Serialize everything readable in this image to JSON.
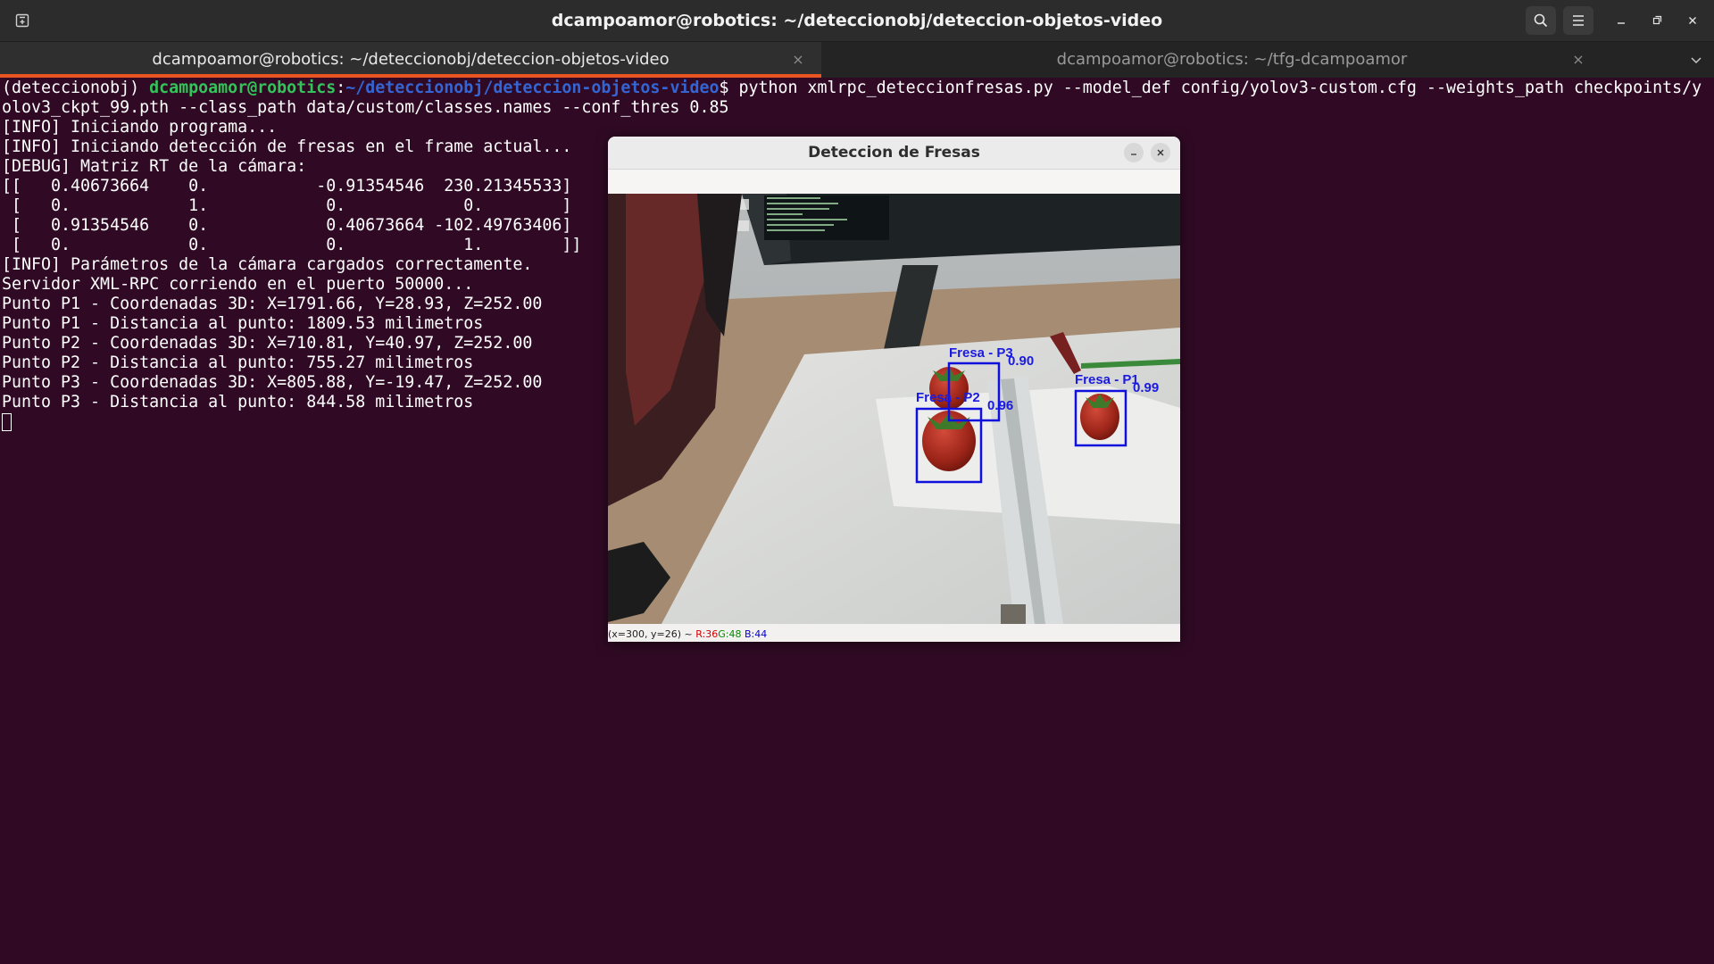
{
  "header": {
    "title": "dcampoamor@robotics: ~/deteccionobj/deteccion-objetos-video",
    "icons": [
      "new-tab-icon",
      "search-icon",
      "hamburger-menu-icon",
      "minimize-icon",
      "maximize-icon",
      "close-icon"
    ]
  },
  "tabs": [
    {
      "label": "dcampoamor@robotics: ~/deteccionobj/deteccion-objetos-video",
      "active": true,
      "close": "×"
    },
    {
      "label": "dcampoamor@robotics: ~/tfg-dcampoamor",
      "active": false,
      "close": "×"
    }
  ],
  "terminal": {
    "prompt": {
      "env": "(deteccionobj) ",
      "user_host": "dcampoamor@robotics",
      "sep": ":",
      "path": "~/deteccionobj/deteccion-objetos-video",
      "dollar": "$ ",
      "command": "python xmlrpc_deteccionfresas.py --model_def config/yolov3-custom.cfg --weights_path checkpoints/y"
    },
    "lines": [
      "olov3_ckpt_99.pth --class_path data/custom/classes.names --conf_thres 0.85",
      "[INFO] Iniciando programa...",
      "[INFO] Iniciando detección de fresas en el frame actual...",
      "[DEBUG] Matriz RT de la cámara:",
      "[[   0.40673664    0.           -0.91354546  230.21345533]",
      " [   0.            1.            0.            0.        ]",
      " [   0.91354546    0.            0.40673664 -102.49763406]",
      " [   0.            0.            0.            1.        ]]",
      "[INFO] Parámetros de la cámara cargados correctamente.",
      "Servidor XML-RPC corriendo en el puerto 50000...",
      "Punto P1 - Coordenadas 3D: X=1791.66, Y=28.93, Z=252.00",
      "Punto P1 - Distancia al punto: 1809.53 milimetros",
      "Punto P2 - Coordenadas 3D: X=710.81, Y=40.97, Z=252.00",
      "Punto P2 - Distancia al punto: 755.27 milimetros",
      "Punto P3 - Coordenadas 3D: X=805.88, Y=-19.47, Z=252.00",
      "Punto P3 - Distancia al punto: 844.58 milimetros"
    ]
  },
  "detection_window": {
    "title": "Deteccion de Fresas",
    "buttons": [
      "minimize",
      "close"
    ],
    "detections": [
      {
        "label": "Fresa - P3",
        "score": "0.90"
      },
      {
        "label": "Fresa - P2",
        "score": "0.96"
      },
      {
        "label": "Fresa - P1",
        "score": "0.99"
      }
    ],
    "status": {
      "coords": "(x=300, y=26) ~ ",
      "r": "R:36",
      "g": "G:48",
      "b": "B:44"
    },
    "box_color": "#1010dd"
  }
}
